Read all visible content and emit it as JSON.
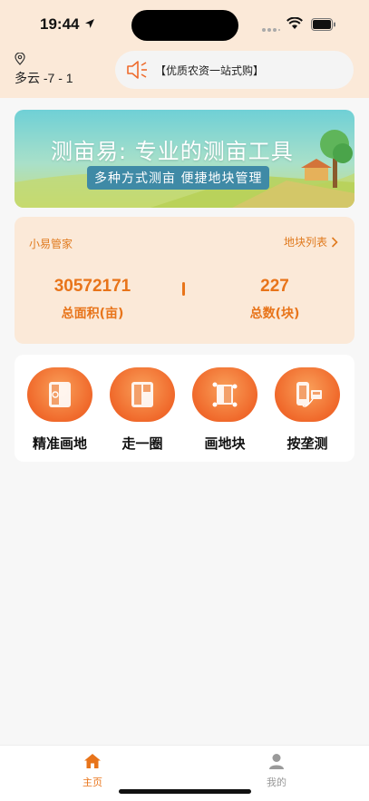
{
  "status_bar": {
    "time": "19:44",
    "icons": [
      "location-arrow-icon",
      "wifi-icon",
      "battery-icon"
    ]
  },
  "header": {
    "weather": "多云 -7 - 1",
    "notice": "【优质农资一站式购】"
  },
  "banner": {
    "title": "测亩易: 专业的测亩工具",
    "subtitle": "多种方式测亩 便捷地块管理"
  },
  "stats": {
    "butler_label": "小易管家",
    "plot_list_label": "地块列表",
    "total_area_value": "30572171",
    "total_area_label": "总面积(亩)",
    "total_count_value": "227",
    "total_count_label": "总数(块)"
  },
  "tools": [
    {
      "label": "精准画地",
      "icon": "precise-draw-icon"
    },
    {
      "label": "走一圈",
      "icon": "walk-around-icon"
    },
    {
      "label": "画地块",
      "icon": "draw-plot-icon"
    },
    {
      "label": "按垄测",
      "icon": "ridge-measure-icon"
    }
  ],
  "tabbar": {
    "home_label": "主页",
    "mine_label": "我的"
  },
  "colors": {
    "accent": "#e8741a",
    "header_bg": "#fbe9d8",
    "tab_active": "#e8741a",
    "tab_inactive": "#999999"
  }
}
